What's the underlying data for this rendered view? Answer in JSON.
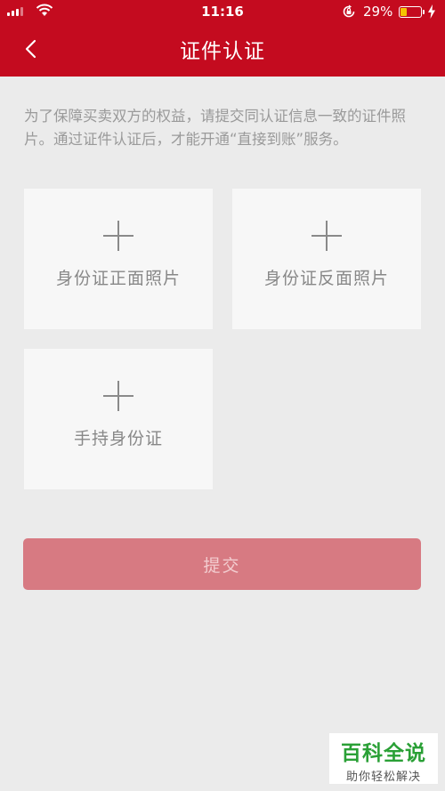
{
  "status_bar": {
    "time": "11:16",
    "battery_percent": "29%",
    "battery_level": 0.29,
    "icons": [
      "signal-icon",
      "wifi-icon",
      "rotation-lock-icon",
      "battery-icon",
      "charging-icon"
    ]
  },
  "header": {
    "title": "证件认证",
    "back_icon": "chevron-left-icon",
    "color": "#c40b1f"
  },
  "notice": "为了保障买卖双方的权益，请提交同认证信息一致的证件照片。通过证件认证后，才能开通“直接到账”服务。",
  "uploads": [
    {
      "label": "身份证正面照片",
      "icon": "plus-icon"
    },
    {
      "label": "身份证反面照片",
      "icon": "plus-icon"
    },
    {
      "label": "手持身份证",
      "icon": "plus-icon"
    }
  ],
  "submit_label": "提交",
  "submit_color": "#d77a82",
  "watermark": {
    "title": "百科全说",
    "subtitle": "助你轻松解决"
  }
}
